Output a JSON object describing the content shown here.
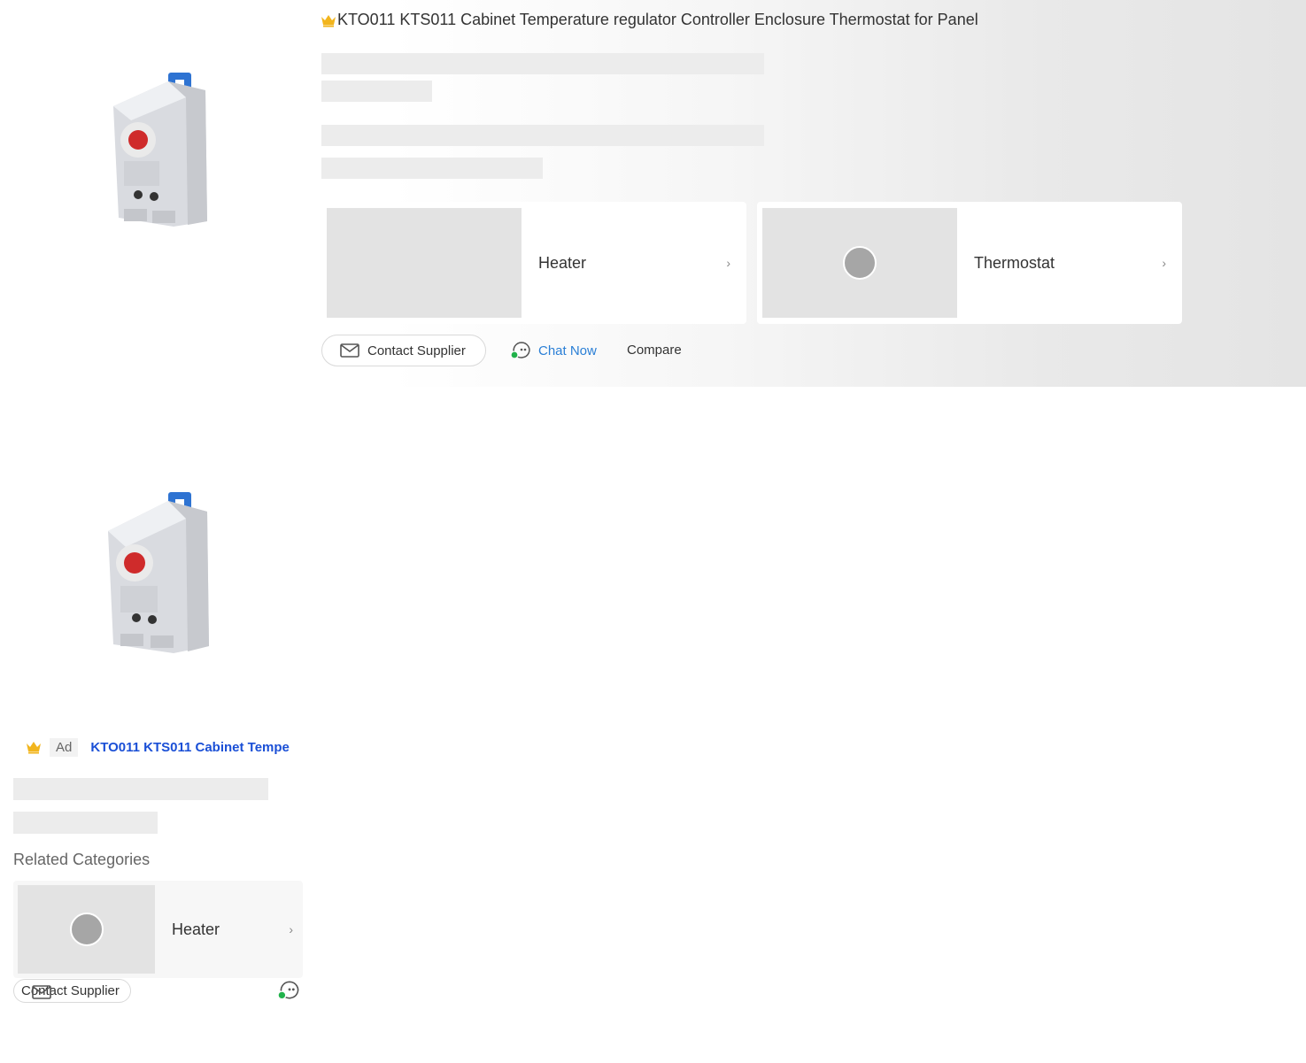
{
  "listing1": {
    "title": "KTO011 KTS011 Cabinet Temperature regulator Controller Enclosure Thermostat for Panel",
    "categories": [
      {
        "label": "Heater",
        "has_dot": false
      },
      {
        "label": "Thermostat",
        "has_dot": true
      }
    ],
    "actions": {
      "contact": "Contact Supplier",
      "chat": "Chat Now",
      "compare": "Compare"
    }
  },
  "listing2": {
    "ad_badge": "Ad",
    "title": "KTO011 KTS011 Cabinet Tempe",
    "related_heading": "Related Categories",
    "category": {
      "label": "Heater"
    },
    "actions": {
      "contact": "Contact Supplier"
    }
  },
  "colors": {
    "link_blue": "#1a4fd6",
    "chat_blue": "#2a7fd6",
    "crown_gold": "#f2b51d",
    "online_green": "#21b24b"
  }
}
